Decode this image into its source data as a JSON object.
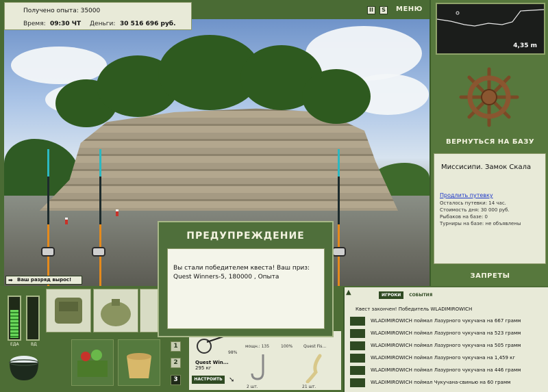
{
  "info": {
    "xp_label": "Получено опыта: 35000",
    "time_label": "Время:",
    "time_value": "09:30 ЧТ",
    "money_label": "Деньги:",
    "money_value": "30 516 696 руб."
  },
  "top": {
    "pause_icon": "II",
    "sound_icon": "S",
    "menu_label": "МЕНЮ"
  },
  "depth": {
    "value": "4,35 m"
  },
  "right": {
    "base_button": "ВЕРНУТЬСЯ НА БАЗУ",
    "location_title": "Миссисипи. Замок Скала",
    "extend_link": "Продлить путевку",
    "lines": [
      "Осталось путевки: 14 час.",
      "Стоимость дня: 30 000 руб.",
      "Рыбаков на базе: 0",
      "Турниры на базе: не объявлены"
    ],
    "bans_button": "ЗАПРЕТЫ"
  },
  "scene": {
    "watermark": "",
    "rank_badge": "Ваш разряд вырос!"
  },
  "modal": {
    "title": "ПРЕДУПРЕЖДЕНИЕ",
    "text": "Вы стали победителем квеста! Ваш приз: Quest Winners-5, 180000 , Опыта"
  },
  "needs": {
    "food_label": "ЕДА",
    "water_label": "ВД",
    "food_level": 0.7,
    "water_level": 0.0
  },
  "tackle": {
    "name": "Quest Win...",
    "weight": "295 кг",
    "setup_button": "НАСТРОИТЬ",
    "pct1": "98%",
    "pct2": "100%",
    "power_label": "мощн.: 135",
    "bait_label": "Quest Fis...",
    "count1": "2 шт.",
    "count2": "21 шт."
  },
  "slots": {
    "n1": "1",
    "n2": "2",
    "n3": "3"
  },
  "events": {
    "tab_players": "ИГРОКИ",
    "tab_events": "СОБЫТИЯ",
    "quest_done": "Квест закончен! Победитель WLADIMIROWICH",
    "rows": [
      "WLADIMIROWICH поймал Лазурного чукучана на 667 грамм",
      "WLADIMIROWICH поймал Лазурного чукучана на 523 грамм",
      "WLADIMIROWICH поймал Лазурного чукучана на 505 грамм",
      "WLADIMIROWICH поймал Лазурного чукучана на 1,459 кг",
      "WLADIMIROWICH поймал Лазурного чукучана на 446 грамм",
      "WLADIMIROWICH поймал Чукучана-свинью на 60 грамм"
    ]
  }
}
